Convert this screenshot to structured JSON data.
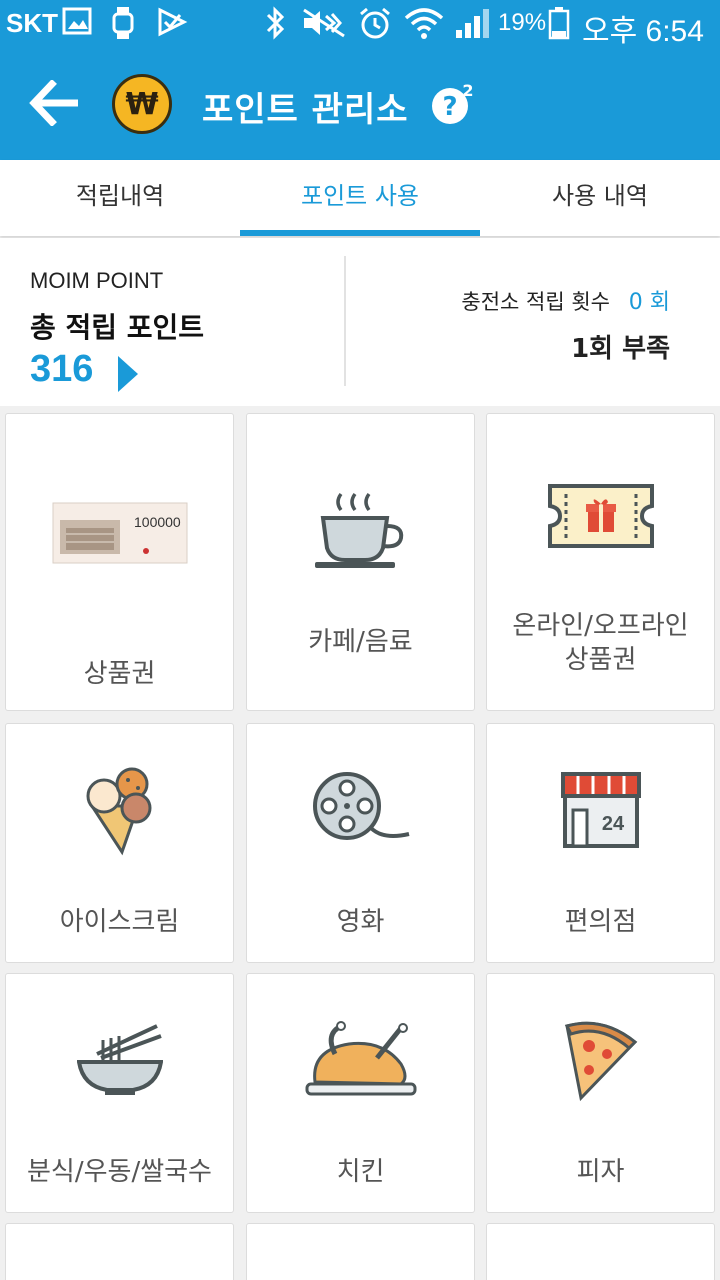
{
  "status_bar": {
    "carrier": "SKT",
    "battery": "19%",
    "time": "오후 6:54"
  },
  "app_bar": {
    "coin_symbol": "₩",
    "title": "포인트 관리소",
    "help_superscript": "2"
  },
  "tabs": [
    {
      "label": "적립내역",
      "active": false
    },
    {
      "label": "포인트 사용",
      "active": true
    },
    {
      "label": "사용 내역",
      "active": false
    }
  ],
  "summary": {
    "brand": "MOIM POINT",
    "total_label": "총 적립 포인트",
    "total_points": "316",
    "count_label": "충전소 적립 횟수",
    "count_value": "0 회",
    "shortfall": "1회 부족"
  },
  "categories": [
    {
      "label": "상품권",
      "icon": "gift-certificate-icon"
    },
    {
      "label": "카페/음료",
      "icon": "coffee-cup-icon"
    },
    {
      "label": "온라인/오프라인\n상품권",
      "label_line1": "온라인/오프라인",
      "label_line2": "상품권",
      "icon": "gift-ticket-icon"
    },
    {
      "label": "아이스크림",
      "icon": "ice-cream-icon"
    },
    {
      "label": "영화",
      "icon": "film-reel-icon"
    },
    {
      "label": "편의점",
      "icon": "convenience-store-icon"
    },
    {
      "label": "분식/우동/쌀국수",
      "icon": "noodle-bowl-icon"
    },
    {
      "label": "치킨",
      "icon": "roast-chicken-icon"
    },
    {
      "label": "피자",
      "icon": "pizza-slice-icon"
    }
  ],
  "voucher_text": "100000",
  "colors": {
    "primary": "#1a9ad8",
    "coin": "#f5b623",
    "background": "#f0f0f0"
  }
}
